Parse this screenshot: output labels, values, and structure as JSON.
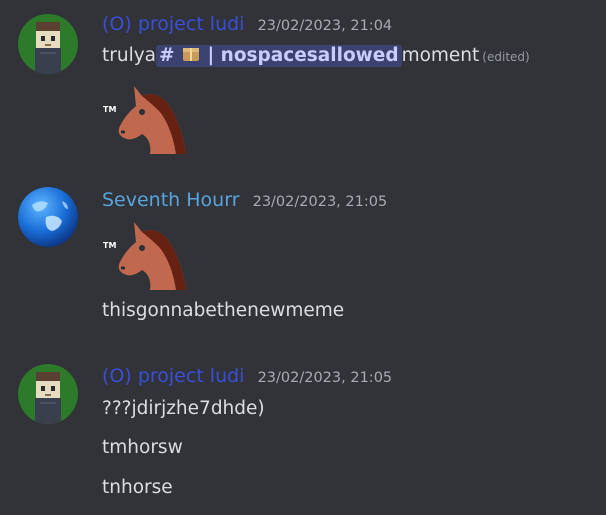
{
  "messages": [
    {
      "author": "(O) project ludi",
      "timestamp": "23/02/2023, 21:04",
      "avatar_icon": "pixel-character-icon",
      "text_prefix": "trulya",
      "mention": {
        "hash": "#",
        "emoji": "package-emoji",
        "separator": "|",
        "channel": "nospacesallowed"
      },
      "text_suffix": "moment",
      "edited_label": "(edited)",
      "emoji_tm": "TM",
      "emoji_name": "horse-tm-emoji"
    },
    {
      "author": "Seventh Hourr",
      "timestamp": "23/02/2023, 21:05",
      "avatar_icon": "globe-icon",
      "emoji_tm": "TM",
      "emoji_name": "horse-tm-emoji",
      "text": "thisgonnabethenewmeme"
    },
    {
      "author": "(O) project ludi",
      "timestamp": "23/02/2023, 21:05",
      "avatar_icon": "pixel-character-icon",
      "lines": [
        "???jdirjzhe7dhde)",
        "tmhorsw",
        "tnhorse"
      ]
    }
  ],
  "colors": {
    "background": "#313338",
    "author_blue": "#3b4ed8",
    "author_cyan": "#58a4dd",
    "mention_bg": "#3c4270"
  }
}
